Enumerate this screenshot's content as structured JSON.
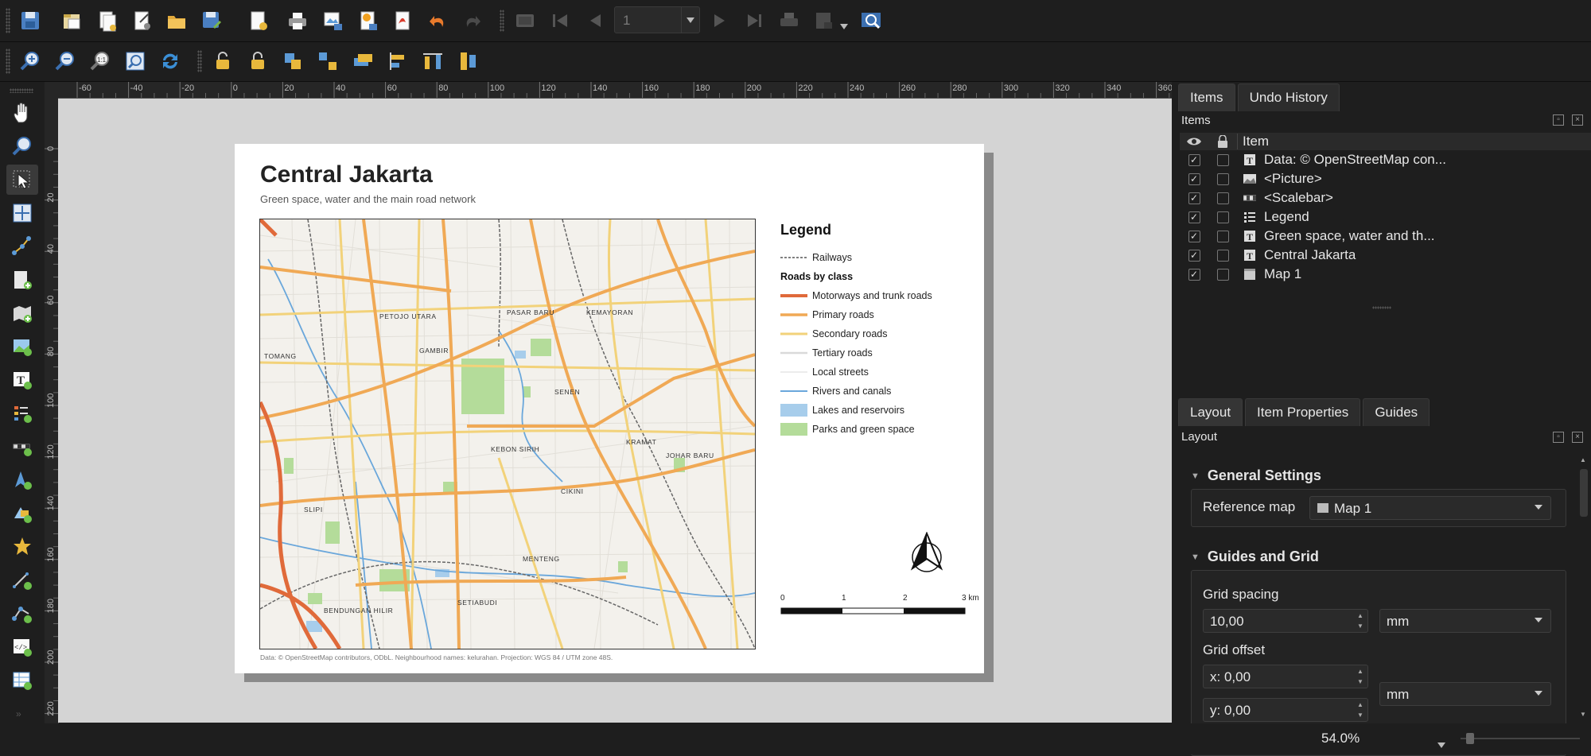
{
  "toolbar": {
    "page_number": "1"
  },
  "ruler": {
    "horizontal_ticks": [
      "-60",
      "-40",
      "-20",
      "0",
      "20",
      "40",
      "60",
      "80",
      "100",
      "120",
      "140",
      "160",
      "180",
      "200",
      "220",
      "240",
      "260",
      "280",
      "300",
      "320",
      "340",
      "360"
    ],
    "vertical_ticks": [
      "0",
      "20",
      "40",
      "60",
      "80",
      "100",
      "120",
      "140",
      "160",
      "180",
      "200",
      "220"
    ]
  },
  "layout_page": {
    "title": "Central Jakarta",
    "subtitle": "Green space, water and the main road network",
    "footer": "Data: © OpenStreetMap contributors, ODbL. Neighbourhood names: kelurahan. Projection: WGS 84 / UTM zone 48S.",
    "map_labels": [
      "PETOJO UTARA",
      "PASAR BARU",
      "KEMAYORAN",
      "TOMANG",
      "GAMBIR",
      "SENEN",
      "KRAMAT",
      "KEBON SIRIH",
      "JOHAR BARU",
      "CIKINI",
      "SLIPI",
      "MENTENG",
      "BENDUNGAN HILIR",
      "SETIABUDI"
    ],
    "legend": {
      "title": "Legend",
      "railways": "Railways",
      "group": "Roads by class",
      "items": [
        {
          "label": "Motorways and trunk roads",
          "color": "#e06a3a"
        },
        {
          "label": "Primary roads",
          "color": "#f0a955"
        },
        {
          "label": "Secondary roads",
          "color": "#f2d27a"
        },
        {
          "label": "Tertiary roads",
          "color": "#d9d9d9"
        },
        {
          "label": "Local streets",
          "color": "#ececec"
        },
        {
          "label": "Rivers and canals",
          "color": "#6aa7db"
        }
      ],
      "fills": [
        {
          "label": "Lakes and reservoirs",
          "color": "#a7cdeb"
        },
        {
          "label": "Parks and green space",
          "color": "#b4dc9a"
        }
      ]
    },
    "scalebar": {
      "ticks": [
        "0",
        "1",
        "2",
        "3 km"
      ]
    }
  },
  "items_panel": {
    "tabs": [
      "Items",
      "Undo History"
    ],
    "title": "Items",
    "column_item": "Item",
    "rows": [
      {
        "label": "Data: © OpenStreetMap con...",
        "icon": "text-icon"
      },
      {
        "label": "<Picture>",
        "icon": "picture-icon"
      },
      {
        "label": "<Scalebar>",
        "icon": "scalebar-icon"
      },
      {
        "label": "Legend",
        "icon": "legend-icon"
      },
      {
        "label": "Green space, water and th...",
        "icon": "text-icon"
      },
      {
        "label": "Central Jakarta",
        "icon": "text-icon"
      },
      {
        "label": "Map 1",
        "icon": "map-icon"
      }
    ],
    "check": "✓"
  },
  "layout_panel": {
    "tabs": [
      "Layout",
      "Item Properties",
      "Guides"
    ],
    "title": "Layout",
    "general_settings": "General Settings",
    "reference_map_label": "Reference map",
    "reference_map_value": "Map 1",
    "guides_grid": "Guides and Grid",
    "grid_spacing_label": "Grid spacing",
    "grid_spacing_value": "10,00",
    "grid_spacing_unit": "mm",
    "grid_offset_label": "Grid offset",
    "offset_x": "x: 0,00",
    "offset_y": "y: 0,00",
    "offset_unit": "mm"
  },
  "status": {
    "zoom": "54.0%"
  }
}
